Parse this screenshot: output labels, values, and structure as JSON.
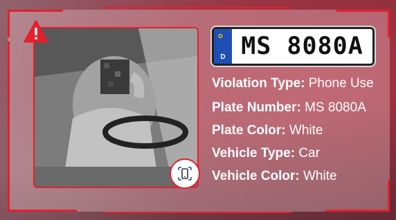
{
  "plate": {
    "country_code": "D",
    "number": "MS 8080A"
  },
  "info": [
    {
      "label": "Violation Type",
      "value": "Phone Use"
    },
    {
      "label": "Plate Number",
      "value": "MS 8080A"
    },
    {
      "label": "Plate Color",
      "value": "White"
    },
    {
      "label": "Vehicle Type",
      "value": "Car"
    },
    {
      "label": "Vehicle Color",
      "value": "White"
    }
  ],
  "icons": {
    "warning": "warning-icon",
    "phone": "phone-icon",
    "eu": "eu-stars-icon"
  },
  "colors": {
    "accent": "#e4202d",
    "plate_blue": "#1f4fb5"
  }
}
